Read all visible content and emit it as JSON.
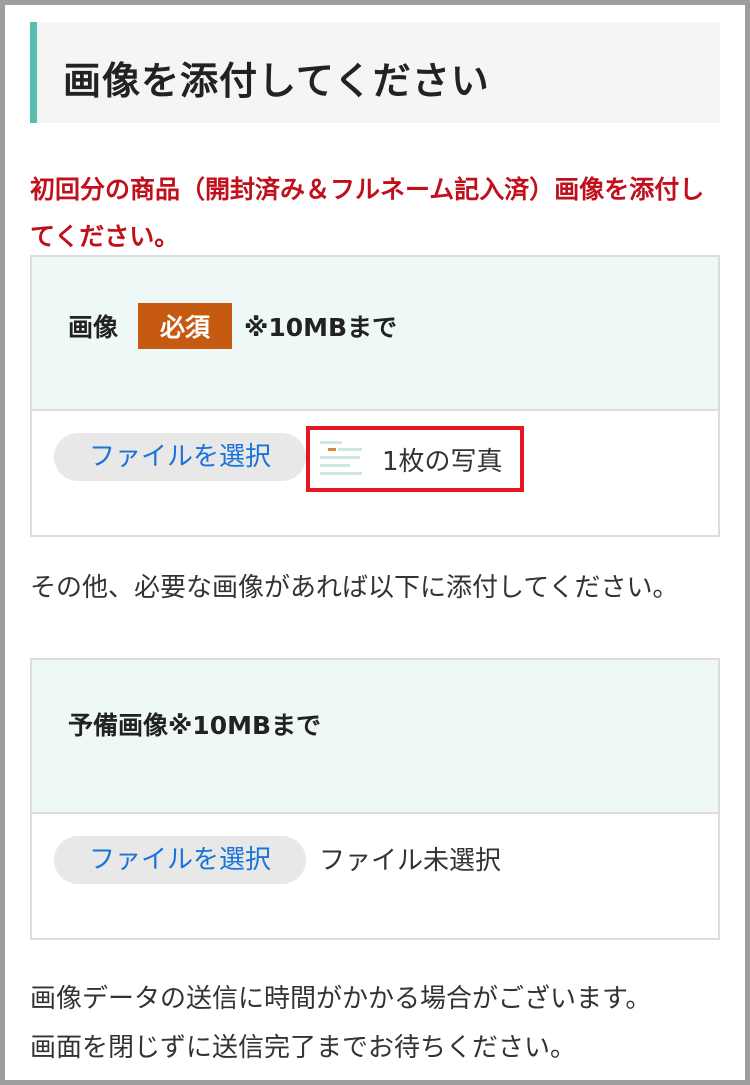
{
  "page": {
    "title": "画像を添付してください",
    "notice": "初回分の商品（開封済み＆フルネーム記入済）画像を添付してください。"
  },
  "field_main": {
    "label": "画像",
    "required_badge": "必須",
    "size_note": "※10MBまで",
    "button_label": "ファイルを選択",
    "file_status": "1枚の写真"
  },
  "extra_note": "その他、必要な画像があれば以下に添付してください。",
  "field_spare": {
    "label": "予備画像※10MBまで",
    "button_label": "ファイルを選択",
    "file_status": "ファイル未選択"
  },
  "footer_note_line1": "画像データの送信に時間がかかる場合がございます。",
  "footer_note_line2": "画面を閉じずに送信完了までお待ちください。",
  "colors": {
    "accent_teal": "#58bfb0",
    "notice_red": "#c0101c",
    "badge_orange": "#c65a10",
    "link_blue": "#1a73d9",
    "highlight_red": "#e5161f"
  },
  "icons": {
    "thumbnail": "image-thumbnail-icon"
  }
}
